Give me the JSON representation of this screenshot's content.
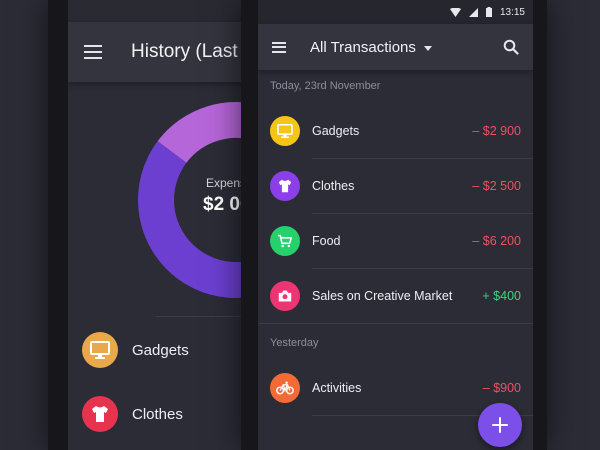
{
  "left_screen": {
    "title": "History (Last",
    "donut_center_label": "Expens",
    "donut_center_value": "$2 00",
    "donut_segments": [
      {
        "color": "#6c3fd0",
        "fraction": 0.78
      },
      {
        "color": "#b566d8",
        "fraction": 0.2
      },
      {
        "color": "#e9a94b",
        "fraction": 0.02
      }
    ],
    "list": [
      {
        "label": "Gadgets",
        "icon": "monitor-icon",
        "color": "#e9a94b"
      },
      {
        "label": "Clothes",
        "icon": "tshirt-icon",
        "color": "#e8334f"
      }
    ]
  },
  "right_screen": {
    "status": {
      "time": "13:15"
    },
    "title": "All Transactions",
    "sections": [
      {
        "header": "Today, 23rd November",
        "items": [
          {
            "label": "Gadgets",
            "amount": "– $2 900",
            "icon": "monitor-icon",
            "color": "#f5c518",
            "amount_color": "#f0505d"
          },
          {
            "label": "Clothes",
            "amount": "– $2 500",
            "icon": "tshirt-icon",
            "color": "#8b3fe8",
            "amount_color": "#f0505d"
          },
          {
            "label": "Food",
            "amount": "– $6 200",
            "icon": "cart-icon",
            "color": "#27d06b",
            "amount_color": "#f0505d"
          },
          {
            "label": "Sales on Creative Market",
            "amount": "+ $400",
            "icon": "camera-icon",
            "color": "#ec3572",
            "amount_color": "#3ad67e"
          }
        ]
      },
      {
        "header": "Yesterday",
        "items": [
          {
            "label": "Activities",
            "amount": "– $900",
            "icon": "bicycle-icon",
            "color": "#f36a37",
            "amount_color": "#f0505d"
          }
        ]
      }
    ],
    "fab": {
      "icon": "plus-icon"
    }
  }
}
